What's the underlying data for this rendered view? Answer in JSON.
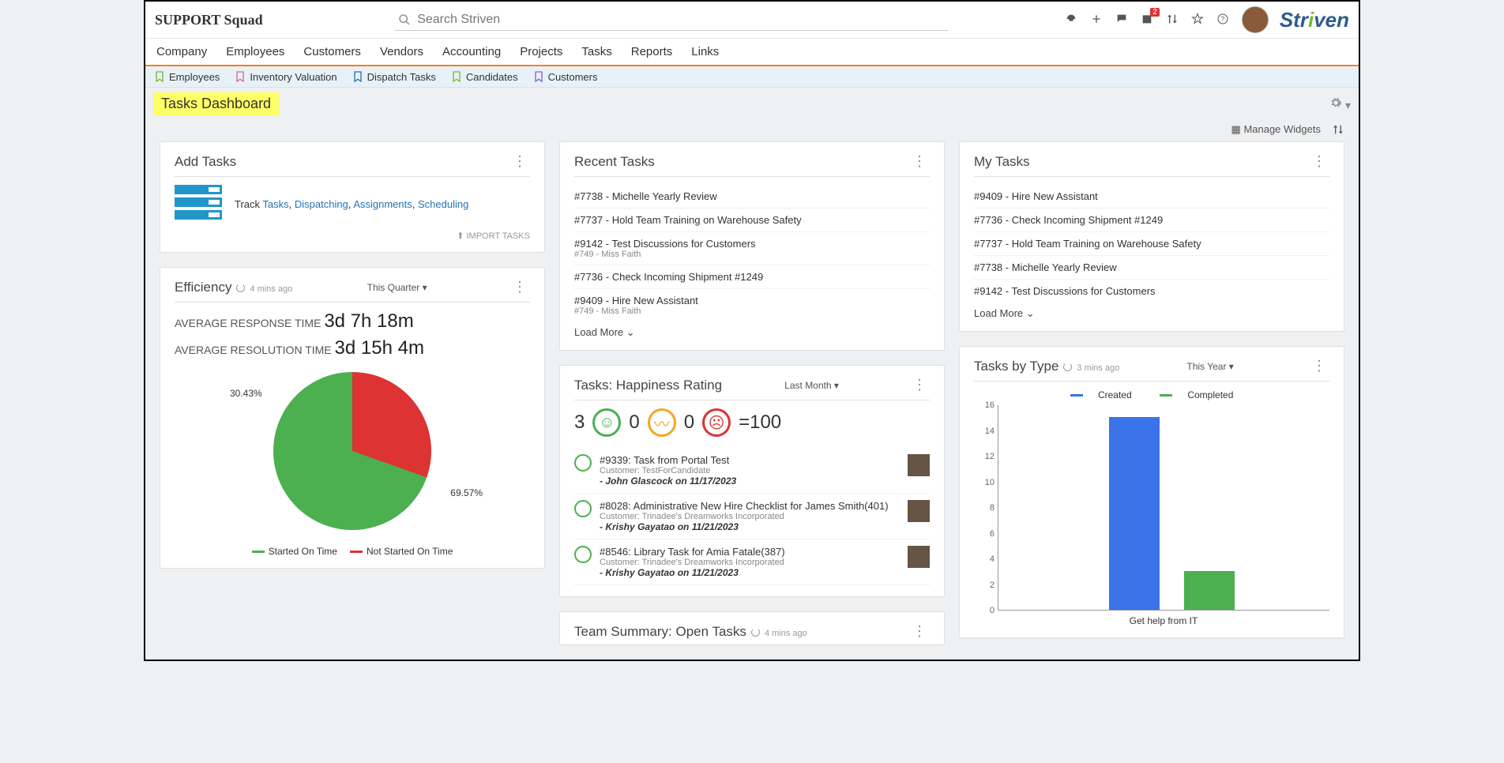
{
  "header": {
    "logo_left": "SUPPORT Squad",
    "search_placeholder": "Search Striven",
    "brand": "Striven",
    "notification_badge": "2"
  },
  "mainnav": [
    "Company",
    "Employees",
    "Customers",
    "Vendors",
    "Accounting",
    "Projects",
    "Tasks",
    "Reports",
    "Links"
  ],
  "quicknav": [
    {
      "label": "Employees",
      "color": "#7ab929"
    },
    {
      "label": "Inventory Valuation",
      "color": "#d76a8a"
    },
    {
      "label": "Dispatch Tasks",
      "color": "#2573b5"
    },
    {
      "label": "Candidates",
      "color": "#7ab929"
    },
    {
      "label": "Customers",
      "color": "#8a5fd3"
    }
  ],
  "page_title": "Tasks Dashboard",
  "toolbar": {
    "manage_widgets": "Manage Widgets"
  },
  "add_tasks": {
    "title": "Add Tasks",
    "track_prefix": "Track ",
    "links": [
      "Tasks",
      "Dispatching",
      "Assignments",
      "Scheduling"
    ],
    "import": "IMPORT TASKS"
  },
  "efficiency": {
    "title": "Efficiency",
    "timestamp": "4 mins ago",
    "filter": "This Quarter",
    "resp_label": "AVERAGE RESPONSE TIME ",
    "resp_val": "3d 7h 18m",
    "resol_label": "AVERAGE RESOLUTION TIME ",
    "resol_val": "3d 15h 4m",
    "pie_a": "30.43%",
    "pie_b": "69.57%",
    "legend_a": "Started On Time",
    "legend_b": "Not Started On Time"
  },
  "recent_tasks": {
    "title": "Recent Tasks",
    "items": [
      {
        "t": "#7738 - Michelle Yearly Review",
        "sub": ""
      },
      {
        "t": "#7737 - Hold Team Training on Warehouse Safety",
        "sub": ""
      },
      {
        "t": "#9142 - Test Discussions for Customers",
        "sub": "#749 - Miss Faith"
      },
      {
        "t": "#7736 - Check Incoming Shipment #1249",
        "sub": ""
      },
      {
        "t": "#9409 - Hire New Assistant",
        "sub": "#749 - Miss Faith"
      }
    ],
    "load_more": "Load More"
  },
  "happiness": {
    "title": "Tasks: Happiness Rating",
    "filter": "Last Month",
    "happy": "3",
    "neutral": "0",
    "sad": "0",
    "score": "=100",
    "items": [
      {
        "t": "#9339: Task from Portal Test",
        "cust": "Customer: TestForCandidate",
        "user": "- John Glascock on 11/17/2023"
      },
      {
        "t": "#8028: Administrative New Hire Checklist for James Smith(401)",
        "cust": "Customer: Trinadee's Dreamworks Incorporated",
        "user": "- Krishy Gayatao on 11/21/2023"
      },
      {
        "t": "#8546: Library Task for Amia Fatale(387)",
        "cust": "Customer: Trinadee's Dreamworks Incorporated",
        "user": "- Krishy Gayatao on 11/21/2023"
      }
    ]
  },
  "team_summary": {
    "title": "Team Summary: Open Tasks",
    "timestamp": "4 mins ago"
  },
  "my_tasks": {
    "title": "My Tasks",
    "items": [
      "#9409 - Hire New Assistant",
      "#7736 - Check Incoming Shipment #1249",
      "#7737 - Hold Team Training on Warehouse Safety",
      "#7738 - Michelle Yearly Review",
      "#9142 - Test Discussions for Customers"
    ],
    "load_more": "Load More"
  },
  "tasks_by_type": {
    "title": "Tasks by Type",
    "timestamp": "3 mins ago",
    "filter": "This Year",
    "legend_created": "Created",
    "legend_completed": "Completed",
    "xlabel": "Get help from IT"
  },
  "chart_data": [
    {
      "type": "pie",
      "title": "Efficiency",
      "series": [
        {
          "name": "Not Started On Time",
          "value": 30.43,
          "color": "#d33"
        },
        {
          "name": "Started On Time",
          "value": 69.57,
          "color": "#4caf50"
        }
      ]
    },
    {
      "type": "bar",
      "title": "Tasks by Type",
      "categories": [
        "Get help from IT"
      ],
      "series": [
        {
          "name": "Created",
          "values": [
            15
          ],
          "color": "#3b73e8"
        },
        {
          "name": "Completed",
          "values": [
            3
          ],
          "color": "#4caf50"
        }
      ],
      "ylim": [
        0,
        16
      ],
      "y_ticks": [
        0,
        2,
        4,
        6,
        8,
        10,
        12,
        14,
        16
      ],
      "xlabel": "Get help from IT",
      "ylabel": ""
    }
  ]
}
